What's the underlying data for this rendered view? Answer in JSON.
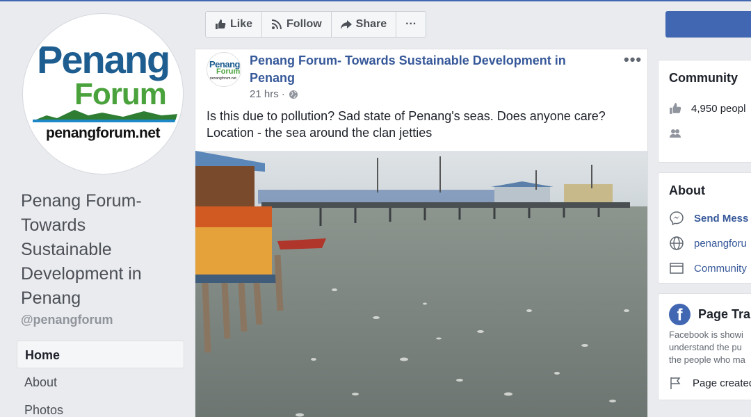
{
  "logo": {
    "line1": "Penang",
    "line2": "Forum",
    "url": "penangforum.net"
  },
  "page": {
    "name": "Penang Forum- Towards Sustainable Development in Penang",
    "handle": "@penangforum"
  },
  "nav": {
    "items": [
      {
        "label": "Home",
        "active": true
      },
      {
        "label": "About",
        "active": false
      },
      {
        "label": "Photos",
        "active": false
      }
    ]
  },
  "actions": {
    "like": "Like",
    "follow": "Follow",
    "share": "Share",
    "more": "···"
  },
  "post": {
    "author": "Penang Forum- Towards Sustainable Development in Penang",
    "time": "21 hrs",
    "separator": "·",
    "more": "•••",
    "text_line1": "Is this due to pollution? Sad state of Penang's seas. Does anyone care?",
    "text_line2": "Location - the sea around the clan jetties"
  },
  "community": {
    "title": "Community",
    "likes": "4,950 peopl"
  },
  "about": {
    "title": "About",
    "message": "Send Mess",
    "website": "penangforu",
    "category": "Community"
  },
  "transparency": {
    "title": "Page Tra",
    "line1": "Facebook is showi",
    "line2": "understand the pu",
    "line3": "the people who ma",
    "created": "Page created"
  },
  "colors": {
    "brand": "#4267b2",
    "link": "#365899",
    "logo_blue": "#1d5d8f",
    "logo_green": "#4aa23c"
  },
  "icons": [
    "like-icon",
    "follow-icon",
    "share-icon",
    "globe-icon",
    "thumbs-up-icon",
    "people-icon",
    "messenger-icon",
    "website-icon",
    "category-icon",
    "facebook-icon",
    "flag-icon"
  ]
}
